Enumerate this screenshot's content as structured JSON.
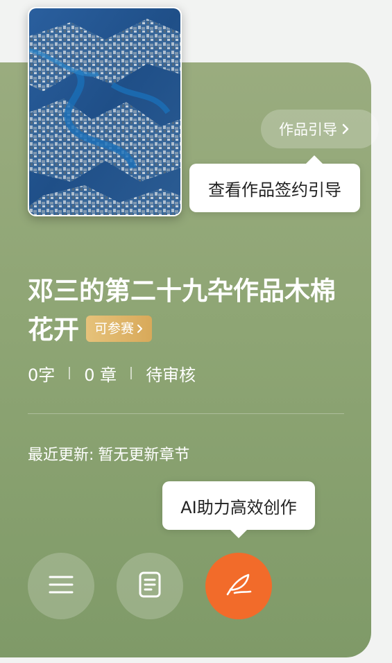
{
  "guide": {
    "label": "作品引导",
    "tooltip": "查看作品签约引导"
  },
  "work": {
    "title": "邓三的第二十九卆作品木棉花开",
    "badge_label": "可参赛"
  },
  "stats": {
    "words": "0字",
    "chapters": "0 章",
    "status": "待审核"
  },
  "update": {
    "label": "最近更新:",
    "value": "暂无更新章节"
  },
  "ai": {
    "tooltip": "AI助力高效创作"
  },
  "icons": {
    "menu": "menu-icon",
    "document": "document-icon",
    "write": "quill-pen-icon",
    "chevron": "chevron-right-icon"
  },
  "colors": {
    "card_green": "#8ea574",
    "badge_gold": "#dcb066",
    "accent_orange": "#f26b2a"
  }
}
